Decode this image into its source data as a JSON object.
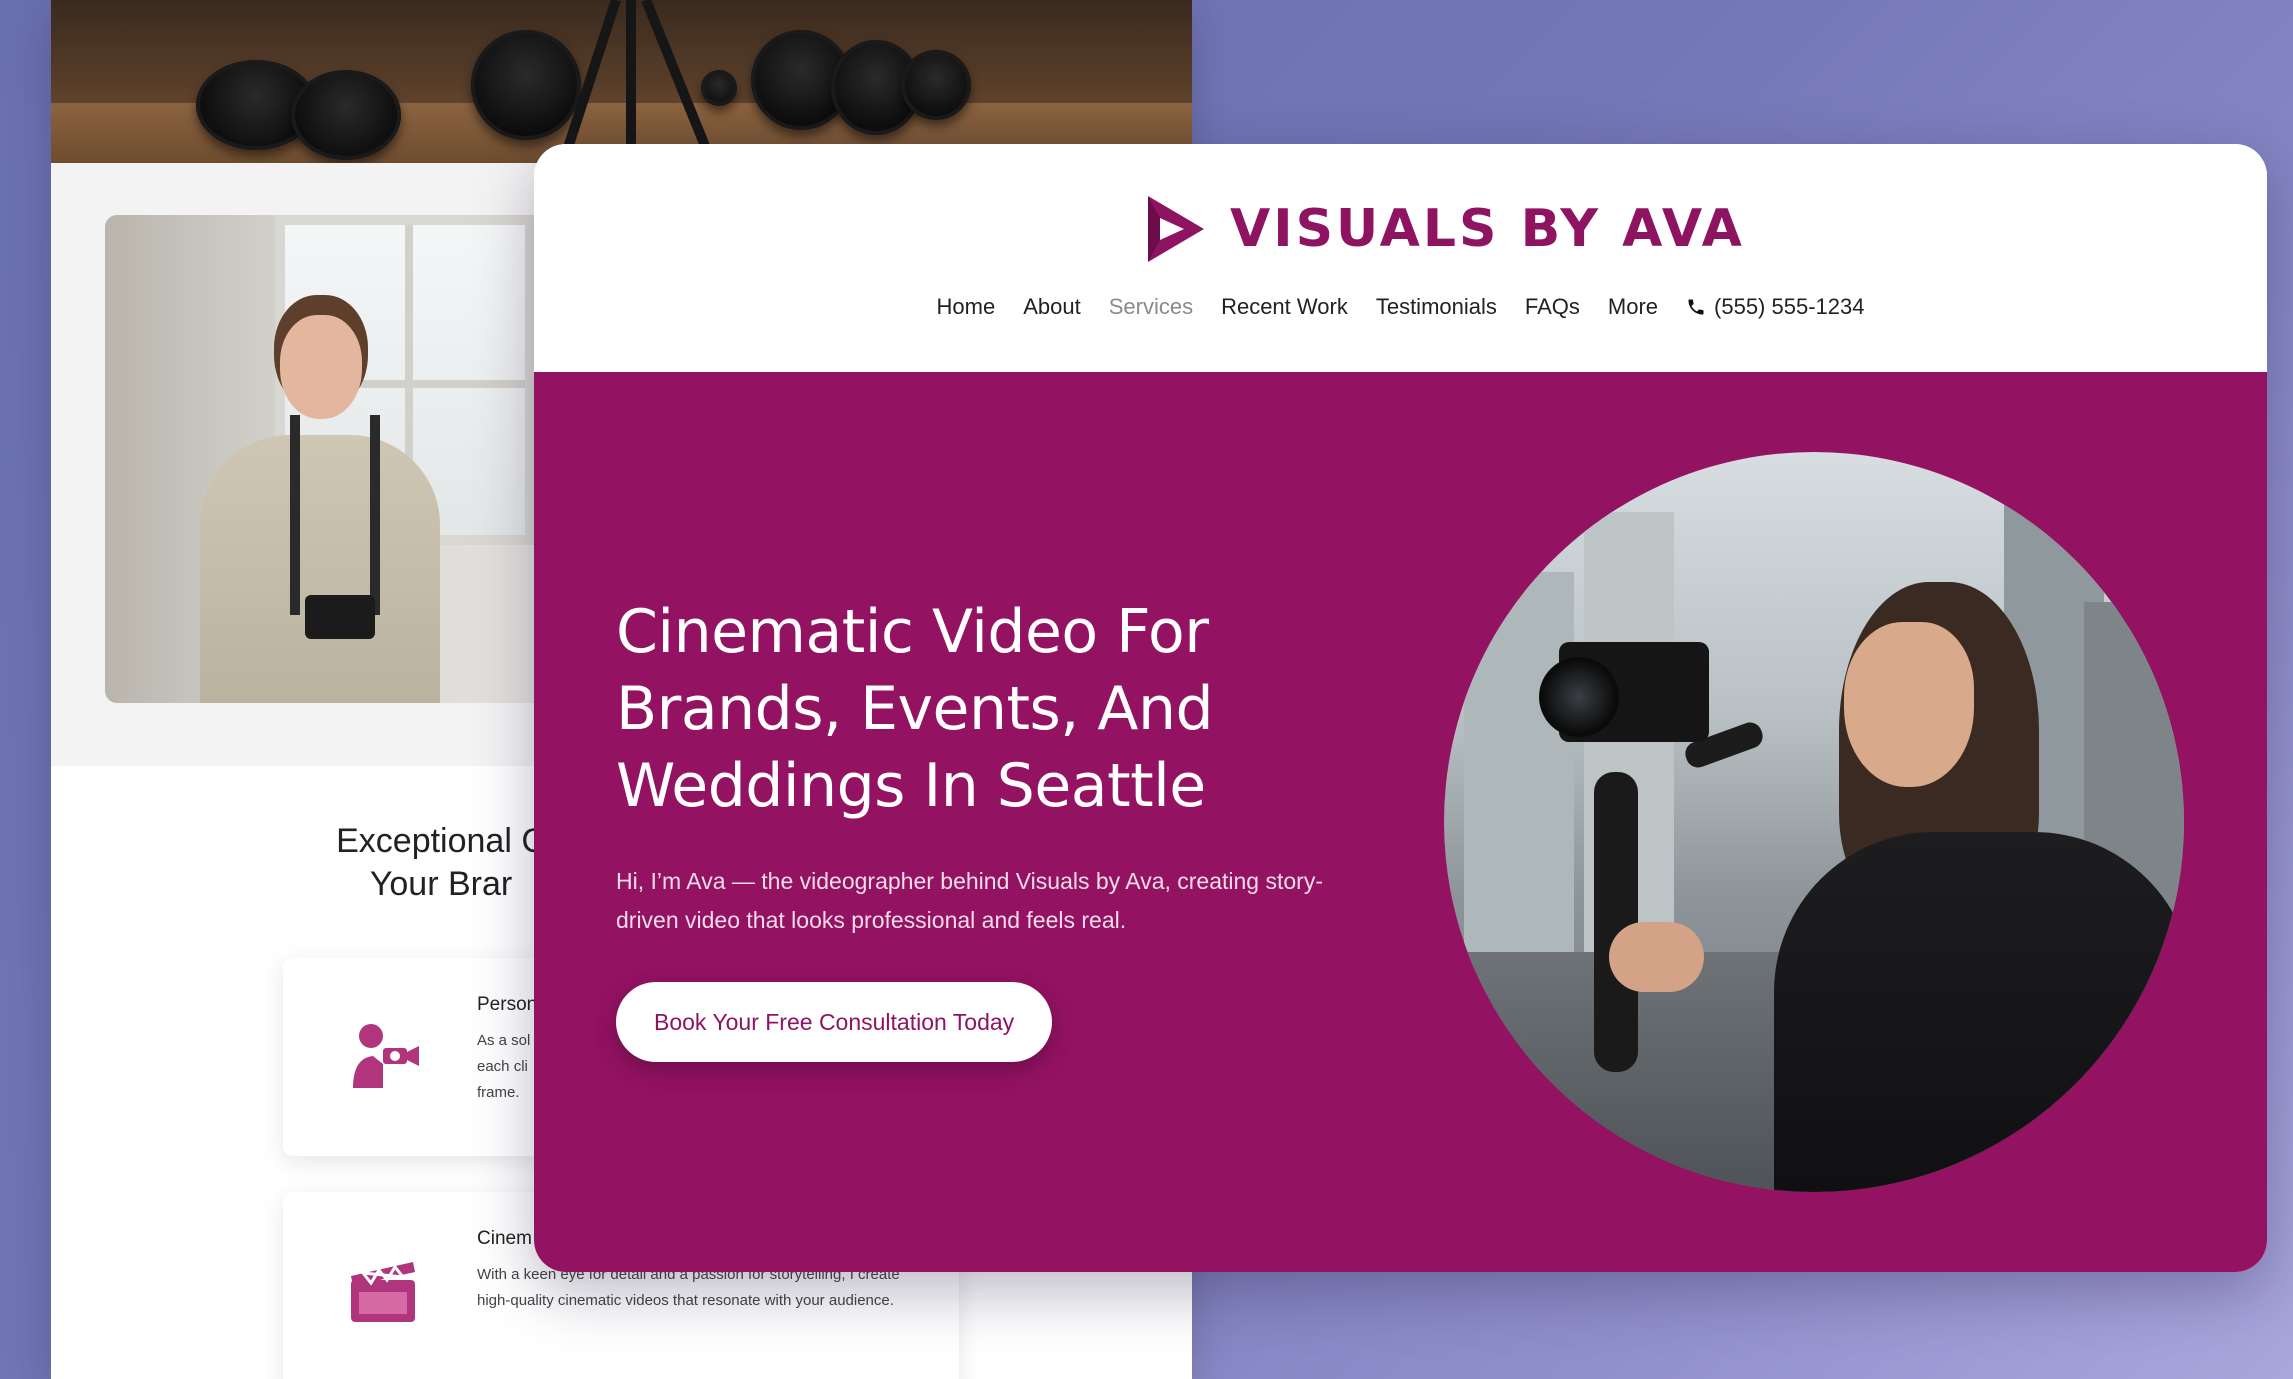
{
  "brand": {
    "name": "VISUALS BY AVA",
    "color": "#931262",
    "text_color": "#8e1461"
  },
  "nav": {
    "items": [
      {
        "label": "Home",
        "active": false
      },
      {
        "label": "About",
        "active": false
      },
      {
        "label": "Services",
        "active": true
      },
      {
        "label": "Recent Work",
        "active": false
      },
      {
        "label": "Testimonials",
        "active": false
      },
      {
        "label": "FAQs",
        "active": false
      },
      {
        "label": "More",
        "active": false
      }
    ],
    "phone_icon": "phone-icon",
    "phone": "(555) 555-1234"
  },
  "hero": {
    "title": "Cinematic Video For Brands, Events, And Weddings In Seattle",
    "subtitle": "Hi, I’m Ava — the videographer behind Visuals by Ava, creating story-driven video that looks professional and feels real.",
    "cta_label": "Book Your Free Consultation Today"
  },
  "back_page": {
    "heading": "Exceptional C\nYour Brar",
    "cards": [
      {
        "icon": "videographer-icon",
        "title": "Person",
        "text": "As a sol\neach cli\nframe."
      },
      {
        "icon": "clapperboard-icon",
        "title": "Cinem",
        "text": "With a keen eye for detail and a passion for storytelling, I create high-quality cinematic videos that resonate with your audience."
      }
    ]
  }
}
